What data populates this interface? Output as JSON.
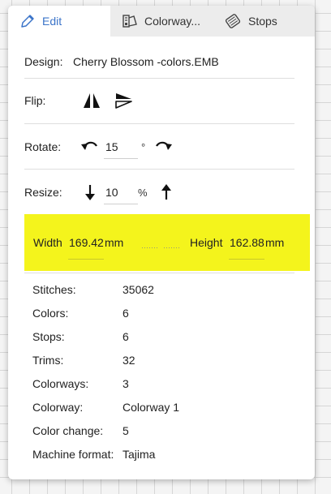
{
  "tabs": [
    {
      "label": "Edit",
      "icon": "pencil-icon",
      "active": true
    },
    {
      "label": "Colorway...",
      "icon": "palette-icon",
      "active": false
    },
    {
      "label": "Stops",
      "icon": "thread-spool-icon",
      "active": false
    }
  ],
  "design": {
    "label": "Design:",
    "value": "Cherry Blossom -colors.EMB"
  },
  "flip": {
    "label": "Flip:"
  },
  "rotate": {
    "label": "Rotate:",
    "value": "15",
    "unit": "°"
  },
  "resize": {
    "label": "Resize:",
    "value": "10",
    "unit": "%"
  },
  "size": {
    "width_label": "Width",
    "width_value": "169.42",
    "width_unit": "mm",
    "height_label": "Height",
    "height_value": "162.88",
    "height_unit": "mm",
    "band_color": "#f4f41c"
  },
  "stats": [
    {
      "key": "Stitches:",
      "value": "35062"
    },
    {
      "key": "Colors:",
      "value": "6"
    },
    {
      "key": "Stops:",
      "value": "6"
    },
    {
      "key": "Trims:",
      "value": "32"
    },
    {
      "key": "Colorways:",
      "value": "3"
    },
    {
      "key": "Colorway:",
      "value": "Colorway 1"
    },
    {
      "key": "Color change:",
      "value": "5"
    },
    {
      "key": "Machine format:",
      "value": "Tajima"
    }
  ]
}
